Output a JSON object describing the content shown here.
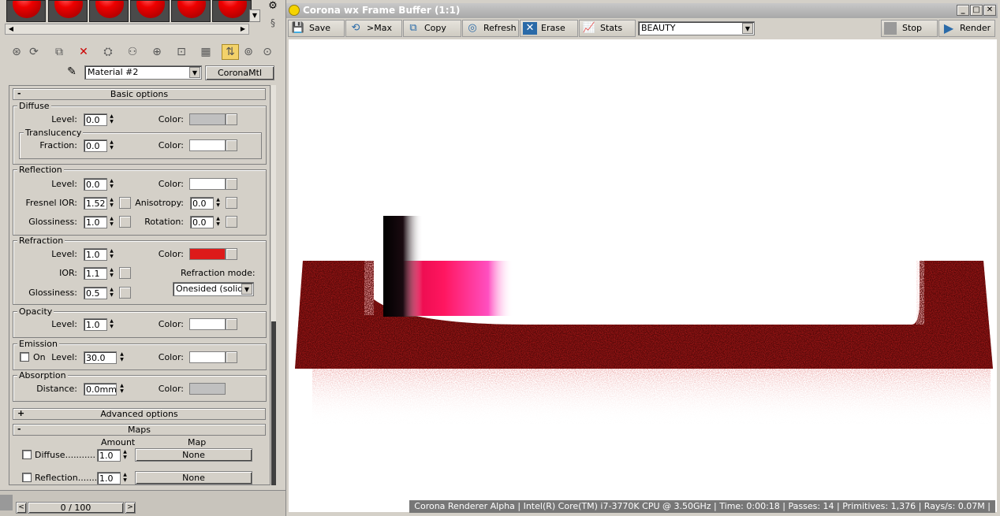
{
  "frame_buffer": {
    "title": "Corona wx Frame Buffer (1:1)",
    "buttons": {
      "save": "Save",
      "to_max": ">Max",
      "copy": "Copy",
      "refresh": "Refresh",
      "erase": "Erase",
      "stats": "Stats",
      "stop": "Stop",
      "render": "Render"
    },
    "channel": "BEAUTY",
    "status": "Corona Renderer Alpha | Intel(R) Core(TM) i7-3770K CPU @ 3.50GHz | Time: 0:00:18 | Passes: 14 | Primitives: 1,376 | Rays/s: 0.07M | "
  },
  "material": {
    "name": "Material #2",
    "type": "CoronaMtl"
  },
  "basic_options": {
    "title": "Basic options",
    "diffuse": {
      "group": "Diffuse",
      "level_label": "Level:",
      "level": "0.0",
      "color_label": "Color:",
      "color": "#c0c0c0",
      "translucency": {
        "group": "Translucency",
        "fraction_label": "Fraction:",
        "fraction": "0.0",
        "color_label": "Color:",
        "color": "#ffffff"
      }
    },
    "reflection": {
      "group": "Reflection",
      "level_label": "Level:",
      "level": "0.0",
      "color_label": "Color:",
      "color": "#ffffff",
      "fresnel_label": "Fresnel IOR:",
      "fresnel": "1.52",
      "anisotropy_label": "Anisotropy:",
      "anisotropy": "0.0",
      "glossiness_label": "Glossiness:",
      "glossiness": "1.0",
      "rotation_label": "Rotation:",
      "rotation": "0.0"
    },
    "refraction": {
      "group": "Refraction",
      "level_label": "Level:",
      "level": "1.0",
      "color_label": "Color:",
      "color": "#dd1a1a",
      "ior_label": "IOR:",
      "ior": "1.1",
      "glossiness_label": "Glossiness:",
      "glossiness": "0.5",
      "mode_label": "Refraction mode:",
      "mode": "Onesided (solid)"
    },
    "opacity": {
      "group": "Opacity",
      "level_label": "Level:",
      "level": "1.0",
      "color_label": "Color:",
      "color": "#ffffff"
    },
    "emission": {
      "group": "Emission",
      "on_label": "On",
      "level_label": "Level:",
      "level": "30.0",
      "color_label": "Color:",
      "color": "#ffffff"
    },
    "absorption": {
      "group": "Absorption",
      "distance_label": "Distance:",
      "distance": "0.0mm",
      "color_label": "Color:",
      "color": "#c0c0c0"
    }
  },
  "advanced_options": {
    "title": "Advanced options"
  },
  "maps": {
    "title": "Maps",
    "amount_header": "Amount",
    "map_header": "Map",
    "rows": [
      {
        "label": "Diffuse.............",
        "amount": "1.0",
        "map": "None"
      },
      {
        "label": "Reflection.........",
        "amount": "1.0",
        "map": "None"
      }
    ]
  },
  "timeline": {
    "frame": "0 / 100"
  },
  "colors": {
    "accent_red": "#ee0000",
    "active_tool": "#f3d26a"
  }
}
